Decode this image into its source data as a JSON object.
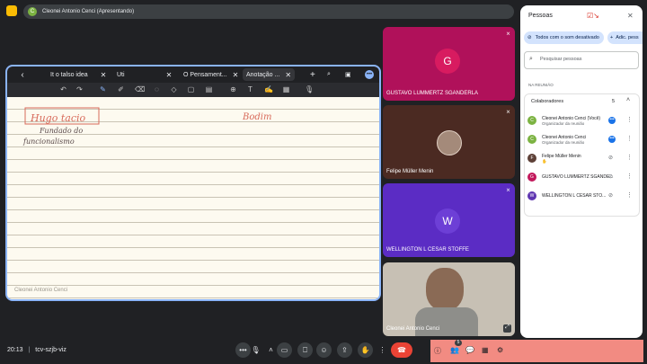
{
  "topbar": {
    "presenter_initial": "C",
    "presenting_text": "Cleonei Antonio Cenci (Apresentando)"
  },
  "shared_screen": {
    "tabs": [
      {
        "label": "It o talso idea"
      },
      {
        "label": "Uti"
      },
      {
        "label": "O Pensament..."
      },
      {
        "label": "Anotação ..."
      }
    ],
    "watermark": "Cleonei Antonio Cenci",
    "handwriting": {
      "boxed": "Hugo tacio",
      "line2": "Fundado do",
      "line3": "funcionalismo",
      "right": "Bodim"
    }
  },
  "tiles": [
    {
      "name": "GUSTAVO LUMMERTZ SGANDERLA",
      "initial": "G",
      "bg": "#b0115a"
    },
    {
      "name": "Felipe Müller Menin",
      "initial": ""
    },
    {
      "name": "WELLINGTON L CESAR STOFFE",
      "initial": "W",
      "bg": "#5b2cc4"
    },
    {
      "name": "Cleonei Antonio Cenci",
      "initial": ""
    }
  ],
  "bottom": {
    "time": "20:13",
    "separator": "|",
    "meeting_code": "tcv-szjb-viz",
    "badge": "5"
  },
  "panel": {
    "title": "Pessoas",
    "mute_all": "Todos com o som desativado",
    "add": "Adic. pess",
    "search_placeholder": "Pesquisar pessoas",
    "section": "NA REUNIÃO",
    "group": "Colaboradores",
    "group_count": "5",
    "people": [
      {
        "name": "Cleonei Antonio Cenci (Você)",
        "role": "Organizador da reunião",
        "initial": "C",
        "color": "#7cb342"
      },
      {
        "name": "Cleonei Antonio Cenci",
        "role": "Organizador da reunião",
        "initial": "C",
        "color": "#7cb342"
      },
      {
        "name": "Felipe Müller Menin",
        "role": "",
        "initial": "F",
        "color": "#5d4037"
      },
      {
        "name": "GUSTAVO LUMMERTZ SGANDE...",
        "role": "",
        "initial": "G",
        "color": "#c2185b"
      },
      {
        "name": "WELLINGTON L CESAR STO...",
        "role": "",
        "initial": "W",
        "color": "#5e35b1"
      }
    ]
  }
}
